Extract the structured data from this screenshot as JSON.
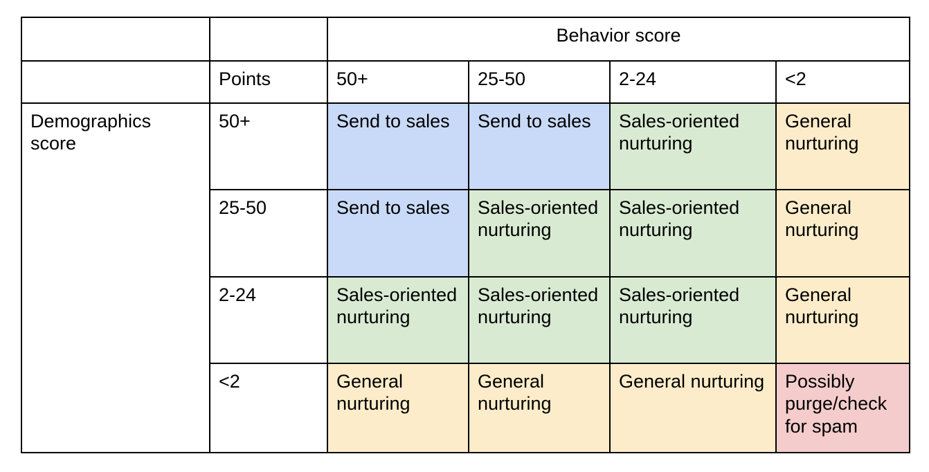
{
  "matrix": {
    "column_group_header": "Behavior score",
    "row_group_header": "Demographics score",
    "points_label": "Points",
    "column_headers": [
      "50+",
      "25-50",
      "2-24",
      "<2"
    ],
    "row_headers": [
      "50+",
      "25-50",
      "2-24",
      "<2"
    ],
    "colors": {
      "send_to_sales": "#c9daf8",
      "sales_oriented_nurturing": "#d9ead3",
      "general_nurturing": "#fcecc9",
      "possibly_purge": "#f4cccc",
      "border": "#000000",
      "background": "#ffffff",
      "text": "#000000"
    },
    "rows": [
      {
        "header": "50+",
        "cells": [
          {
            "text": "Send to sales",
            "color": "blue"
          },
          {
            "text": "Send to sales",
            "color": "blue"
          },
          {
            "text": "Sales-oriented nurturing",
            "color": "green"
          },
          {
            "text": "General nurturing",
            "color": "yellow"
          }
        ]
      },
      {
        "header": "25-50",
        "cells": [
          {
            "text": "Send to sales",
            "color": "blue"
          },
          {
            "text": "Sales-oriented nurturing",
            "color": "green"
          },
          {
            "text": "Sales-oriented nurturing",
            "color": "green"
          },
          {
            "text": "General nurturing",
            "color": "yellow"
          }
        ]
      },
      {
        "header": "2-24",
        "cells": [
          {
            "text": "Sales-oriented nurturing",
            "color": "green"
          },
          {
            "text": "Sales-oriented nurturing",
            "color": "green"
          },
          {
            "text": "Sales-oriented nurturing",
            "color": "green"
          },
          {
            "text": "General nurturing",
            "color": "yellow"
          }
        ]
      },
      {
        "header": "<2",
        "cells": [
          {
            "text": "General nurturing",
            "color": "yellow"
          },
          {
            "text": "General nurturing",
            "color": "yellow"
          },
          {
            "text": "General nurturing",
            "color": "yellow"
          },
          {
            "text": "Possibly purge/check for spam",
            "color": "pink"
          }
        ]
      }
    ]
  }
}
